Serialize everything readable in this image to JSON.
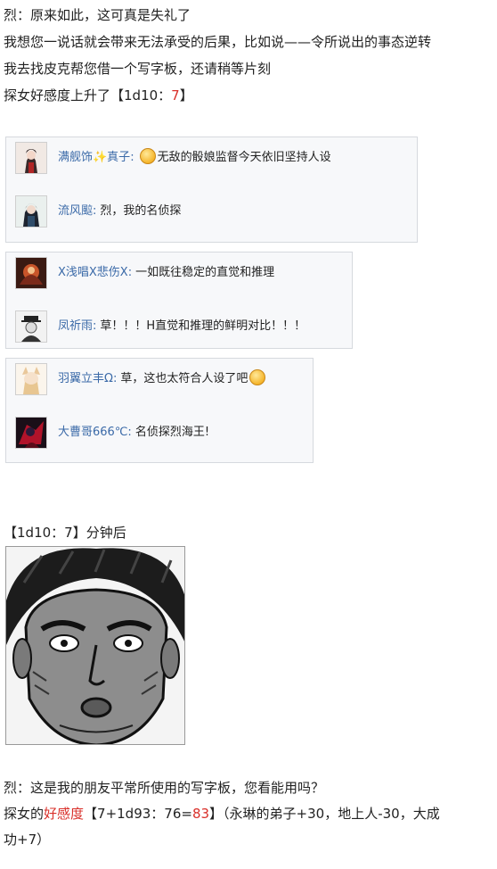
{
  "post_top": {
    "line1": "烈：原来如此，这可真是失礼了",
    "line2": "我想您一说话就会带来无法承受的后果，比如说——令所说出的事态逆转",
    "line3": "我去找皮克帮您借一个写字板，还请稍等片刻",
    "line4_prefix": "探女好感度上升了【1d10：",
    "line4_value": "7",
    "line4_suffix": "】"
  },
  "comment_groups": [
    {
      "comments": [
        {
          "user": "满舰饰✨真子",
          "sep": ":",
          "text": "无敌的骰娘监督今天依旧坚持人设",
          "emoji_before": true,
          "emoji_after": false
        },
        {
          "user": "流风䬃",
          "sep": ":",
          "text": "烈，我的名侦探",
          "emoji_before": false,
          "emoji_after": false
        }
      ]
    },
    {
      "comments": [
        {
          "user": "X浅唱X悲伤X",
          "sep": ":",
          "text": "一如既往稳定的直觉和推理",
          "emoji_before": false,
          "emoji_after": false
        },
        {
          "user": "凤祈雨",
          "sep": ":",
          "text": "草！！！H直觉和推理的鲜明对比！！！",
          "emoji_before": false,
          "emoji_after": false
        }
      ]
    },
    {
      "comments": [
        {
          "user": "羽翼立丰Ω",
          "sep": ":",
          "text": "草，这也太符合人设了吧",
          "emoji_before": false,
          "emoji_after": true
        },
        {
          "user": "大曹哥666℃",
          "sep": ":",
          "text": "名侦探烈海王!",
          "emoji_before": false,
          "emoji_after": false
        }
      ]
    }
  ],
  "timer_line": "【1d10：7】分钟后",
  "post_bottom": {
    "line1": "烈：这是我的朋友平常所使用的写字板，您看能用吗？",
    "line2_prefix": "探女的",
    "line2_red1": "好感度",
    "line2_mid": "【7+1d93：76=",
    "line2_red2": "83",
    "line2_suffix": "】（永琳的弟子+30，地上人-30，大成",
    "line3": "功+7）"
  },
  "icons": {
    "emoji": "smiley-emoji-icon",
    "avatar": "user-avatar",
    "manga": "manga-face-image"
  },
  "colors": {
    "username": "#3b6aa8",
    "highlight": "#d9302a",
    "comment_bg": "#f7f8fa",
    "comment_border": "#d6d9de"
  }
}
